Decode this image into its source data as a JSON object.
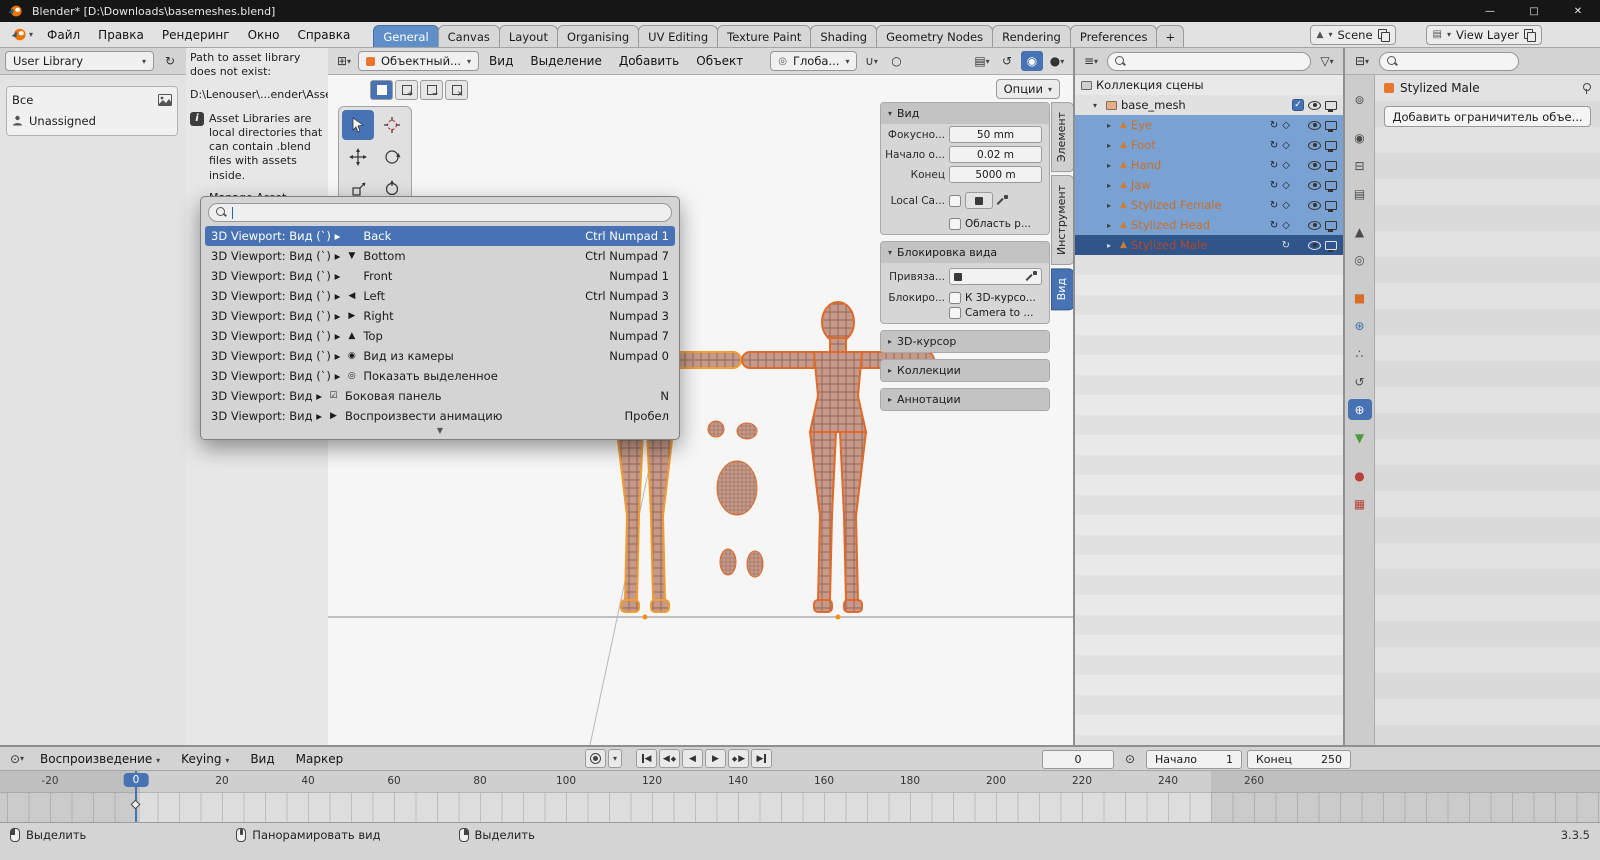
{
  "icons": {
    "dropdown": "▾",
    "expand_closed": "▸",
    "expand_open": "▾",
    "check": "✓",
    "minimize": "—",
    "maximize": "□",
    "close": "✕",
    "refresh": "↻",
    "info": "i",
    "more_below": "▼",
    "editor_viewport": "⊞",
    "editor_outliner": "≡",
    "editor_properties": "⊟",
    "editor_timeline": "⊙",
    "scene": "▲",
    "view_layer": "▤",
    "orientation": "◎",
    "snap_magnet": "∪",
    "proportional": "○",
    "overlays": "▤",
    "gizmos": "↺",
    "xray": "◉",
    "shading": "●",
    "funnel": "▽",
    "clock": "⊙",
    "tool_tabs": {
      "tool": "⊚",
      "render": "◉",
      "output": "⊟",
      "view_layer": "▤",
      "scene": "▲",
      "world": "◎",
      "object": "■",
      "modifiers": "⊛",
      "particles": "∴",
      "physics": "↺",
      "constraints": "⊕",
      "object_data": "▼",
      "material": "●",
      "texture": "▦"
    }
  },
  "titlebar": {
    "title": "Blender* [D:\\Downloads\\basemeshes.blend]"
  },
  "topbar": {
    "menus": [
      "Файл",
      "Правка",
      "Рендеринг",
      "Окно",
      "Справка"
    ],
    "workspaces": [
      "General",
      "Canvas",
      "Layout",
      "Organising",
      "UV Editing",
      "Texture Paint",
      "Shading",
      "Geometry Nodes",
      "Rendering",
      "Preferences"
    ],
    "add_workspace": "+",
    "scene_label": "Scene",
    "view_layer_label": "View Layer"
  },
  "asset_browser": {
    "library_select": "User Library",
    "catalog_all": "Все",
    "catalog_unassigned": "Unassigned",
    "warning_heading": "Path to asset library does not exist:",
    "warning_path": "D:\\Lenouser\\...ender\\Assets",
    "info_paragraph_1": "Asset Libraries are local directories that can contain .blend files with assets inside.",
    "info_paragraph_2": "Manage Asset Libraries from the File Paths section in"
  },
  "viewport_header": {
    "mode_select": "Объектный...",
    "menus": [
      "Вид",
      "Выделение",
      "Добавить",
      "Объект"
    ],
    "orientation_select": "Глоба...",
    "options_button": "Опции"
  },
  "search_popup": {
    "query": "",
    "items": [
      {
        "path": "3D Viewport: Вид (`) ▸",
        "icon": "",
        "name": "Back",
        "shortcut": "Ctrl Numpad 1"
      },
      {
        "path": "3D Viewport: Вид (`) ▸",
        "icon": "▼",
        "name": "Bottom",
        "shortcut": "Ctrl Numpad 7"
      },
      {
        "path": "3D Viewport: Вид (`) ▸",
        "icon": "",
        "name": "Front",
        "shortcut": "Numpad 1"
      },
      {
        "path": "3D Viewport: Вид (`) ▸",
        "icon": "◀",
        "name": "Left",
        "shortcut": "Ctrl Numpad 3"
      },
      {
        "path": "3D Viewport: Вид (`) ▸",
        "icon": "▶",
        "name": "Right",
        "shortcut": "Numpad 3"
      },
      {
        "path": "3D Viewport: Вид (`) ▸",
        "icon": "▲",
        "name": "Top",
        "shortcut": "Numpad 7"
      },
      {
        "path": "3D Viewport: Вид (`) ▸",
        "icon": "◉",
        "name": "Вид из камеры",
        "shortcut": "Numpad 0"
      },
      {
        "path": "3D Viewport: Вид (`) ▸",
        "icon": "◎",
        "name": "Показать выделенное",
        "shortcut": ""
      },
      {
        "path": "3D Viewport: Вид ▸",
        "icon": "☑",
        "name": "Боковая панель",
        "shortcut": "N"
      },
      {
        "path": "3D Viewport: Вид ▸",
        "icon": "▶",
        "name": "Воспроизвести анимацию",
        "shortcut": "Пробел"
      }
    ]
  },
  "n_panel": {
    "view": {
      "title": "Вид",
      "focal_label": "Фокусно...",
      "focal_value": "50 mm",
      "clip_start_label": "Начало о...",
      "clip_start_value": "0.02 m",
      "clip_end_label": "Конец",
      "clip_end_value": "5000 m",
      "local_camera_label": "Local Ca...",
      "render_region_label": "Область р..."
    },
    "view_lock": {
      "title": "Блокировка вида",
      "lock_to_object_label": "Привяза...",
      "lock_label": "Блокиро...",
      "to_3d_cursor_label": "К 3D-курсо...",
      "camera_to_view_label": "Camera to ..."
    },
    "collapsed_sections": [
      "3D-курсор",
      "Коллекции",
      "Аннотации"
    ],
    "tabs": [
      "Элемент",
      "Инструмент",
      "Вид"
    ]
  },
  "outliner": {
    "scene_collection_label": "Коллекция сцены",
    "collection_name": "base_mesh",
    "objects": [
      {
        "name": "Eye"
      },
      {
        "name": "Foot"
      },
      {
        "name": "Hand"
      },
      {
        "name": "Jaw"
      },
      {
        "name": "Stylized Female"
      },
      {
        "name": "Stylized Head"
      },
      {
        "name": "Stylized Male"
      }
    ]
  },
  "properties": {
    "active_object_label": "Stylized Male",
    "add_constraint_button": "Добавить ограничитель объе..."
  },
  "timeline": {
    "playback_menu": "Воспроизведение",
    "keying_menu": "Keying",
    "view_menu": "Вид",
    "marker_menu": "Маркер",
    "current_frame": "0",
    "playhead_frame": "0",
    "start_label": "Начало",
    "start_value": "1",
    "end_label": "Конец",
    "end_value": "250",
    "ruler_labels": [
      "-20",
      "0",
      "20",
      "40",
      "60",
      "80",
      "100",
      "120",
      "140",
      "160",
      "180",
      "200",
      "220",
      "240",
      "260"
    ]
  },
  "statusbar": {
    "hint_left": "Выделить",
    "hint_middle": "Панорамировать вид",
    "hint_right": "Выделить",
    "version": "3.3.5"
  }
}
